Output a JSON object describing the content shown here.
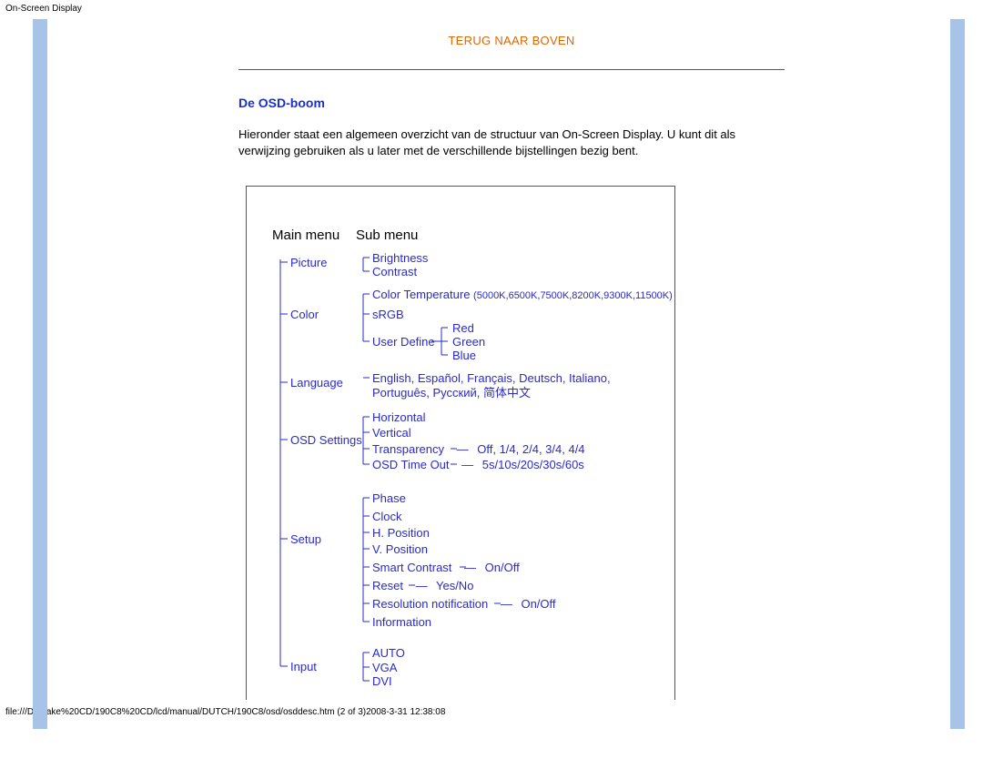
{
  "page_title": "On-Screen Display",
  "top_link": "TERUG NAAR BOVEN",
  "section_heading": "De OSD-boom",
  "intro_text": "Hieronder staat een algemeen overzicht van de structuur van On-Screen Display. U kunt dit als verwijzing gebruiken als u later met de verschillende bijstellingen bezig bent.",
  "col_main": "Main menu",
  "col_sub": "Sub menu",
  "main": {
    "picture": "Picture",
    "color": "Color",
    "language": "Language",
    "osd_settings": "OSD Settings",
    "setup": "Setup",
    "input": "Input"
  },
  "sub": {
    "brightness": "Brightness",
    "contrast": "Contrast",
    "color_temp": "Color Temperature",
    "color_temp_vals": "(5000K,6500K,7500K,8200K,9300K,11500K)",
    "srgb": "sRGB",
    "user_define": "User Define",
    "red": "Red",
    "green": "Green",
    "blue": "Blue",
    "languages": "English, Español, Français, Deutsch, Italiano, Português, Русский, 简体中文",
    "horizontal": "Horizontal",
    "vertical": "Vertical",
    "transparency": "Transparency",
    "transparency_vals": "Off, 1/4, 2/4, 3/4, 4/4",
    "osd_timeout": "OSD Time Out",
    "osd_timeout_vals": "5s/10s/20s/30s/60s",
    "phase": "Phase",
    "clock": "Clock",
    "hpos": "H. Position",
    "vpos": "V. Position",
    "smart_contrast": "Smart Contrast",
    "onoff": "On/Off",
    "reset": "Reset",
    "yesno": "Yes/No",
    "res_notif": "Resolution notification",
    "information": "Information",
    "auto": "AUTO",
    "vga": "VGA",
    "dvi": "DVI"
  },
  "dash": "—",
  "footer": "file:///D|/make%20CD/190C8%20CD/lcd/manual/DUTCH/190C8/osd/osddesc.htm (2 of 3)2008-3-31 12:38:08"
}
